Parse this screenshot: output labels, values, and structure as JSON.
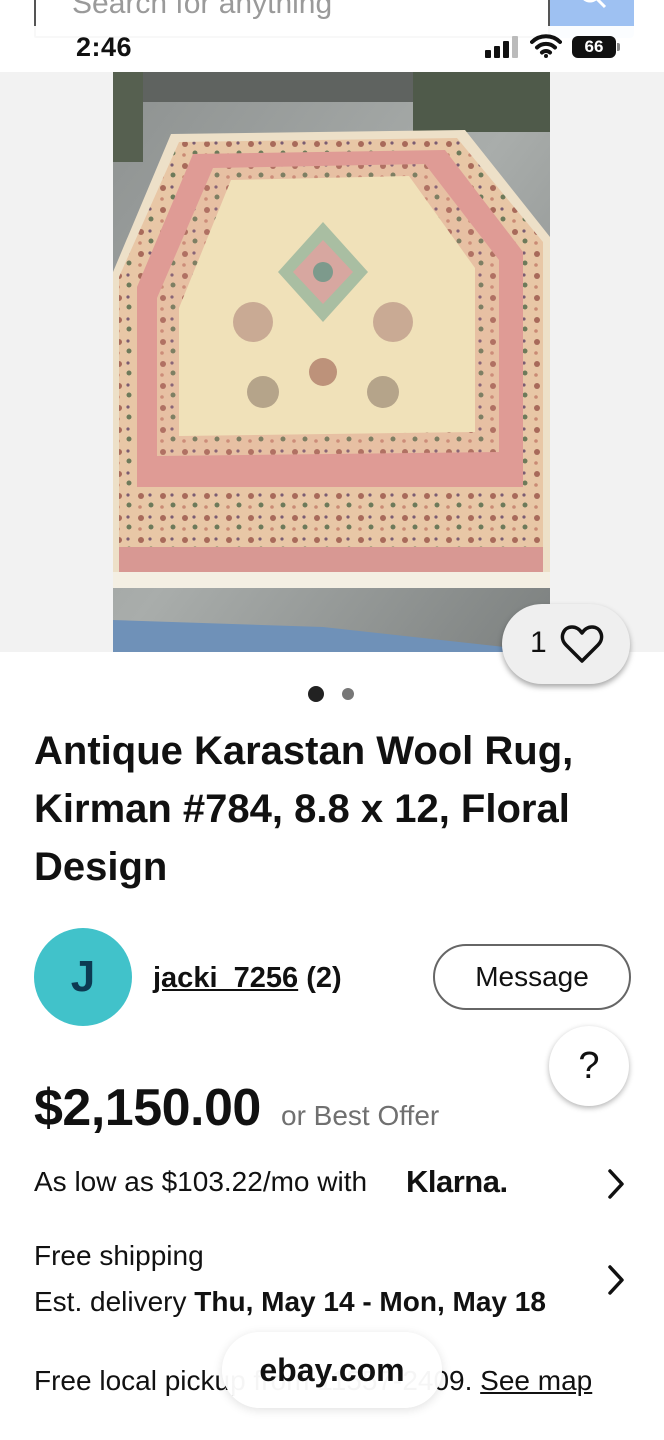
{
  "search": {
    "placeholder": "Search for anything"
  },
  "status_bar": {
    "time": "2:46",
    "battery": "66"
  },
  "gallery": {
    "like_count": "1",
    "total_images": 2,
    "active_image_index": 0
  },
  "listing": {
    "title": "Antique Karastan Wool Rug, Kirman #784, 8.8 x 12, Floral Design",
    "seller": {
      "avatar_letter": "J",
      "username": "jacki_7256",
      "feedback": "(2)"
    },
    "message_label": "Message",
    "help_label": "?",
    "price": "$2,150.00",
    "offer_text": "or Best Offer",
    "klarna": {
      "text": "As low as $103.22/mo with",
      "logo": "Klarna."
    },
    "shipping": {
      "line1": "Free shipping",
      "delivery_prefix": "Est. delivery",
      "delivery_dates": "Thu, May 14 - Mon, May 18"
    },
    "pickup": {
      "text": "Free local pickup from 11557-2409.",
      "link": "See map"
    }
  },
  "browser": {
    "url": "ebay.com"
  },
  "colors": {
    "avatar_bg": "#41c2ca",
    "search_button": "#9ec1f2"
  }
}
